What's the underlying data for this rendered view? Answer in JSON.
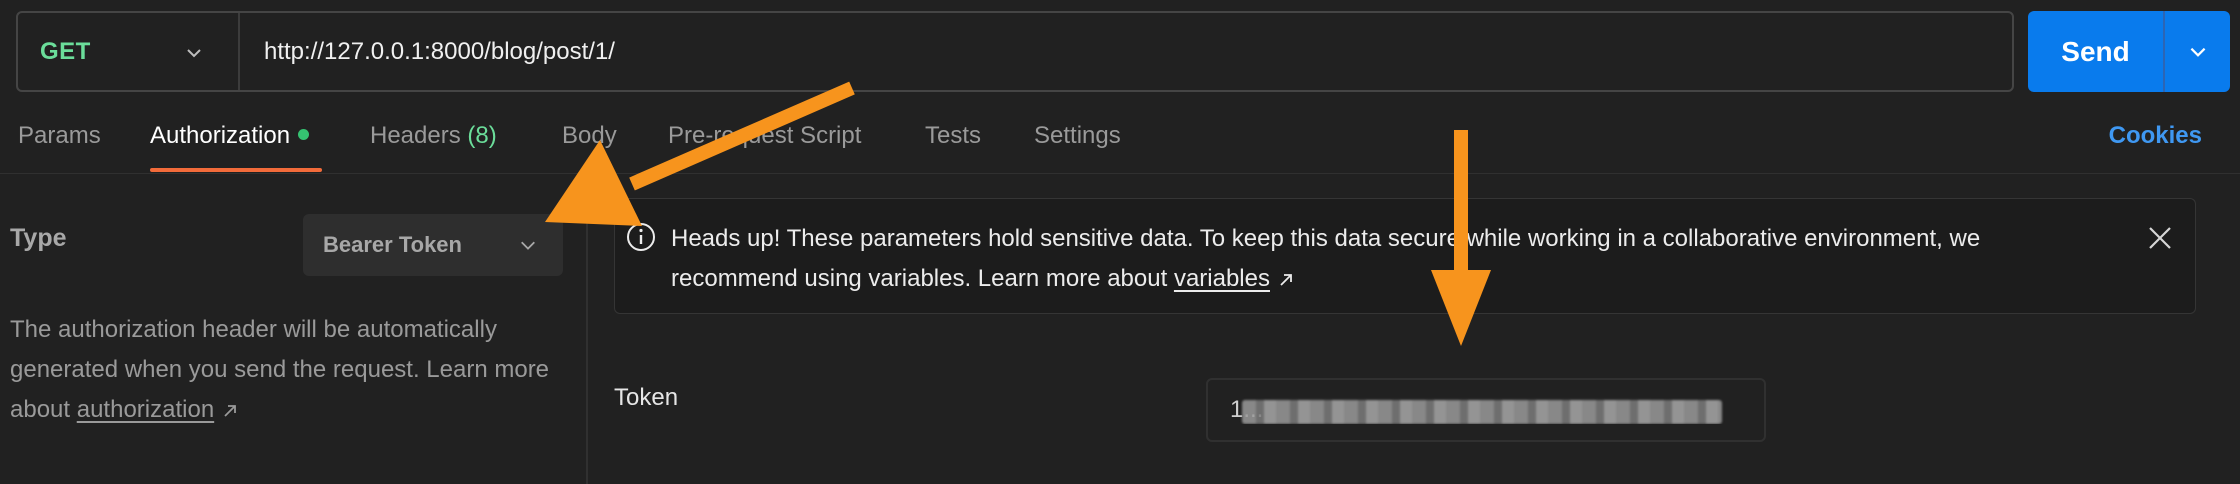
{
  "request": {
    "method": "GET",
    "url": "http://127.0.0.1:8000/blog/post/1/",
    "send_label": "Send"
  },
  "tabs": [
    {
      "label": "Params"
    },
    {
      "label": "Authorization",
      "active": true
    },
    {
      "label": "Headers",
      "count": "(8)"
    },
    {
      "label": "Body"
    },
    {
      "label": "Pre-request Script"
    },
    {
      "label": "Tests"
    },
    {
      "label": "Settings"
    }
  ],
  "cookies_label": "Cookies",
  "auth": {
    "type_label": "Type",
    "type_value": "Bearer Token",
    "description_prefix": "The authorization header will be automatically generated when you send the request. Learn more about ",
    "description_link": "authorization"
  },
  "banner": {
    "text_prefix": "Heads up! These parameters hold sensitive data. To keep this data secure while working in a collaborative environment, we recommend using variables. Learn more about ",
    "link": "variables"
  },
  "token": {
    "label": "Token",
    "value": "1..."
  },
  "colors": {
    "accent_blue": "#097bed",
    "method_green": "#6bdd9a",
    "active_underline": "#f26b3a",
    "annotation_arrow": "#f7941d"
  },
  "icons": {
    "method_dropdown": "chevron-down-icon",
    "send_dropdown": "chevron-down-icon",
    "info": "info-circle-icon",
    "close": "close-icon",
    "external_link": "arrow-up-right-icon"
  }
}
